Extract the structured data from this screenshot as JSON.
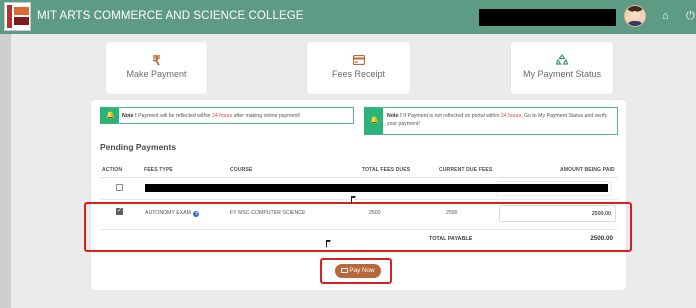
{
  "header": {
    "title": "MIT ARTS COMMERCE AND SCIENCE COLLEGE",
    "logo_text": "MIT Arts Commerce & Science College",
    "icons": [
      "user-avatar",
      "home-icon",
      "power-icon"
    ]
  },
  "cards": [
    {
      "label": "Make Payment",
      "icon": "rupee-icon"
    },
    {
      "label": "Fees Receipt",
      "icon": "receipt-icon"
    },
    {
      "label": "My Payment Status",
      "icon": "recycle-icon"
    }
  ],
  "notes": {
    "note1": {
      "bold": "Note !",
      "pre": "Payment will be reflected within",
      "highlight": "24 hours",
      "post": "after making online payment!"
    },
    "note2": {
      "bold": "Note !",
      "pre": "If Payment is not reflected on portal within",
      "highlight": "24 hours",
      "post": ", Go to My Payment Status and verify your payment!"
    }
  },
  "pending": {
    "title": "Pending Payments",
    "columns": [
      "ACTION",
      "FEES TYPE",
      "COURSE",
      "TOTAL FEES DUES",
      "CURRENT DUE FEES",
      "AMOUNT BEING PAID"
    ],
    "rows": [
      {
        "checked": true,
        "fees_type": "AUTONOMY EXAM",
        "course": "FY MSC-COMPUTER SCIENCE",
        "total_dues": "2500",
        "current_due": "2500",
        "amount_paid": "2500.00"
      }
    ],
    "total_label": "TOTAL PAYABLE",
    "total_value": "2500.00"
  },
  "pay_button": {
    "label": "Pay Now"
  },
  "colors": {
    "header": "#5e9b84",
    "accent": "#b5683a",
    "note_green": "#29b47a",
    "highlight_red": "#d71f1f"
  }
}
